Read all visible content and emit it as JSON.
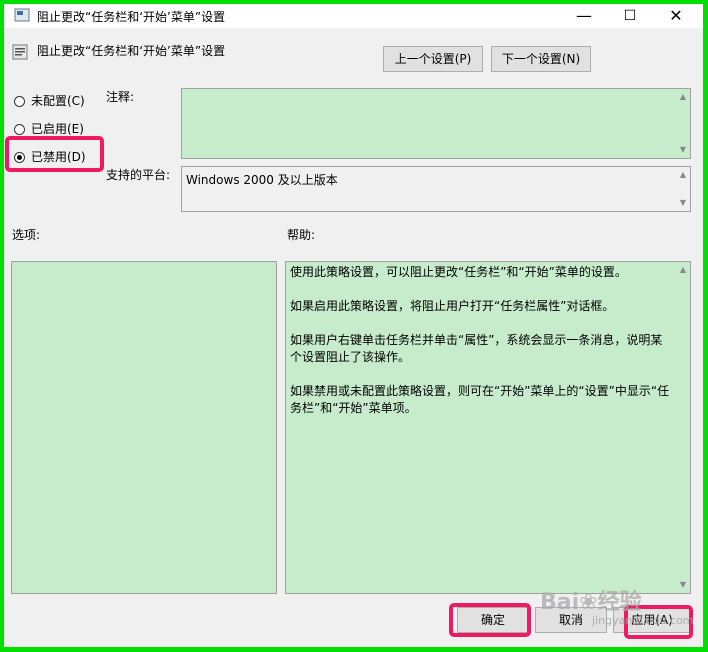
{
  "window": {
    "title": "阻止更改“任务栏和‘开始’菜单”设置",
    "controls": {
      "minimize": "—",
      "maximize": "☐",
      "close": "✕"
    }
  },
  "header": {
    "policy_name": "阻止更改“任务栏和‘开始’菜单”设置"
  },
  "nav": {
    "prev_label": "上一个设置(P)",
    "next_label": "下一个设置(N)"
  },
  "state": {
    "options": [
      {
        "label": "未配置(C)",
        "selected": false
      },
      {
        "label": "已启用(E)",
        "selected": false
      },
      {
        "label": "已禁用(D)",
        "selected": true
      }
    ]
  },
  "comment": {
    "label": "注释:",
    "value": ""
  },
  "platform": {
    "label": "支持的平台:",
    "value": "Windows 2000 及以上版本"
  },
  "options_section": {
    "label": "选项:"
  },
  "help": {
    "label": "帮助:",
    "paragraphs": [
      "使用此策略设置，可以阻止更改“任务栏”和“开始”菜单的设置。",
      "如果启用此策略设置，将阻止用户打开“任务栏属性”对话框。",
      "如果用户右键单击任务栏并单击“属性”，系统会显示一条消息，说明某个设置阻止了该操作。",
      "如果禁用或未配置此策略设置，则可在“开始”菜单上的“设置”中显示“任务栏”和“开始”菜单项。"
    ]
  },
  "footer": {
    "ok_label": "确定",
    "cancel_label": "取消",
    "apply_label": "应用(A)"
  },
  "watermark": {
    "text": "Bai❀经验",
    "sub": "jingyan.baidu.com"
  },
  "colors": {
    "frame": "#00e000",
    "highlight": "#ee1a62",
    "pane": "#c7eccc"
  }
}
